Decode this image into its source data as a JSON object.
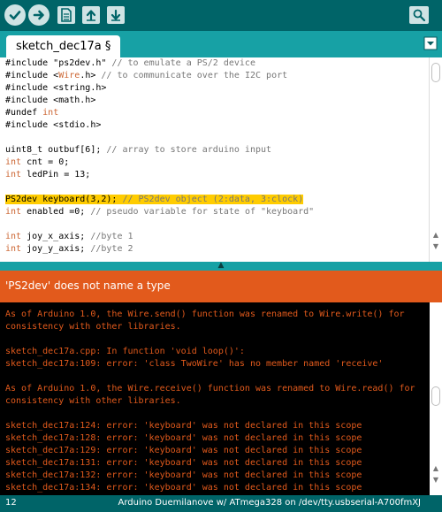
{
  "toolbar": {
    "buttons": [
      {
        "name": "verify",
        "icon": "checkmark-icon"
      },
      {
        "name": "upload",
        "icon": "right-arrow-icon"
      },
      {
        "name": "new",
        "icon": "new-document-icon"
      },
      {
        "name": "open",
        "icon": "up-arrow-icon"
      },
      {
        "name": "save",
        "icon": "down-arrow-icon"
      },
      {
        "name": "serial-monitor",
        "icon": "magnifier-icon"
      }
    ]
  },
  "tab": {
    "label": "sketch_dec17a §"
  },
  "editor": {
    "lines": [
      [
        {
          "t": "#include \"ps2dev.h\" "
        },
        {
          "t": "// to emulate a PS/2 device",
          "c": "cm"
        }
      ],
      [
        {
          "t": "#include <"
        },
        {
          "t": "Wire",
          "c": "kw"
        },
        {
          "t": ".h> "
        },
        {
          "t": "// to communicate over the I2C port",
          "c": "cm"
        }
      ],
      [
        {
          "t": "#include <string.h>"
        }
      ],
      [
        {
          "t": "#include <math.h>"
        }
      ],
      [
        {
          "t": "#undef "
        },
        {
          "t": "int",
          "c": "kw"
        }
      ],
      [
        {
          "t": "#include <stdio.h>"
        }
      ],
      [
        {
          "t": ""
        }
      ],
      [
        {
          "t": "uint8_t outbuf[6]; "
        },
        {
          "t": "// array to store arduino input",
          "c": "cm"
        }
      ],
      [
        {
          "t": "int",
          "c": "kw"
        },
        {
          "t": " cnt = 0;"
        }
      ],
      [
        {
          "t": "int",
          "c": "kw"
        },
        {
          "t": " ledPin = 13;"
        }
      ],
      [
        {
          "t": ""
        }
      ],
      [
        {
          "t": "PS2dev keyboard(3,2); ",
          "c": "hl"
        },
        {
          "t": "// PS2dev object (2:data, 3:clock)",
          "c": "cm hl"
        }
      ],
      [
        {
          "t": "int",
          "c": "kw"
        },
        {
          "t": " enabled =0; "
        },
        {
          "t": "// pseudo variable for state of \"keyboard\"",
          "c": "cm"
        }
      ],
      [
        {
          "t": ""
        }
      ],
      [
        {
          "t": "int",
          "c": "kw"
        },
        {
          "t": " joy_x_axis; "
        },
        {
          "t": "//byte 1",
          "c": "cm"
        }
      ],
      [
        {
          "t": "int",
          "c": "kw"
        },
        {
          "t": " joy_y_axis; "
        },
        {
          "t": "//byte 2",
          "c": "cm"
        }
      ]
    ]
  },
  "message": {
    "text": "'PS2dev' does not name a type"
  },
  "console": {
    "lines": [
      "As of Arduino 1.0, the Wire.send() function was renamed to Wire.write() for",
      "consistency with other libraries.",
      "",
      "sketch_dec17a.cpp: In function 'void loop()':",
      "sketch_dec17a:109: error: 'class TwoWire' has no member named 'receive'",
      "",
      "As of Arduino 1.0, the Wire.receive() function was renamed to Wire.read() for",
      "consistency with other libraries.",
      "",
      "sketch_dec17a:124: error: 'keyboard' was not declared in this scope",
      "sketch_dec17a:128: error: 'keyboard' was not declared in this scope",
      "sketch_dec17a:129: error: 'keyboard' was not declared in this scope",
      "sketch_dec17a:131: error: 'keyboard' was not declared in this scope",
      "sketch_dec17a:132: error: 'keyboard' was not declared in this scope",
      "sketch_dec17a:134: error: 'keyboard' was not declared in this scope"
    ]
  },
  "status": {
    "line_number": "12",
    "board": "Arduino Duemilanove w/ ATmega328 on /dev/tty.usbserial-A700fmXJ"
  },
  "colors": {
    "toolbar_bg": "#006468",
    "tabbar_bg": "#17a1a5",
    "keyword": "#cc6633",
    "comment": "#777777",
    "highlight": "#ffcc00",
    "error_bar": "#e25a1c",
    "console_text": "#e25a1c"
  }
}
